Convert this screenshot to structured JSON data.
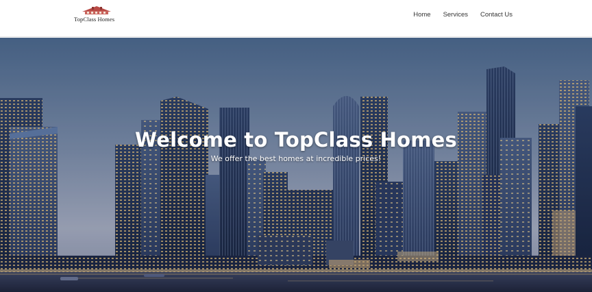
{
  "brand": {
    "logo_text": "TopClass Homes",
    "logo_icon": "house-roof-icon"
  },
  "nav": {
    "home": "Home",
    "services": "Services",
    "contact": "Contact Us"
  },
  "hero": {
    "title": "Welcome to TopClass Homes",
    "subtitle": "We offer the best homes at incredible prices!",
    "background": "city-skyline-dusk-image"
  },
  "colors": {
    "sky_top": "#4f6d90",
    "sky_bottom": "#9aa6b9",
    "building": "#1e2c4a",
    "window_light": "#e9c47a",
    "nav_text": "#333333",
    "logo_roof": "#b94a45"
  }
}
